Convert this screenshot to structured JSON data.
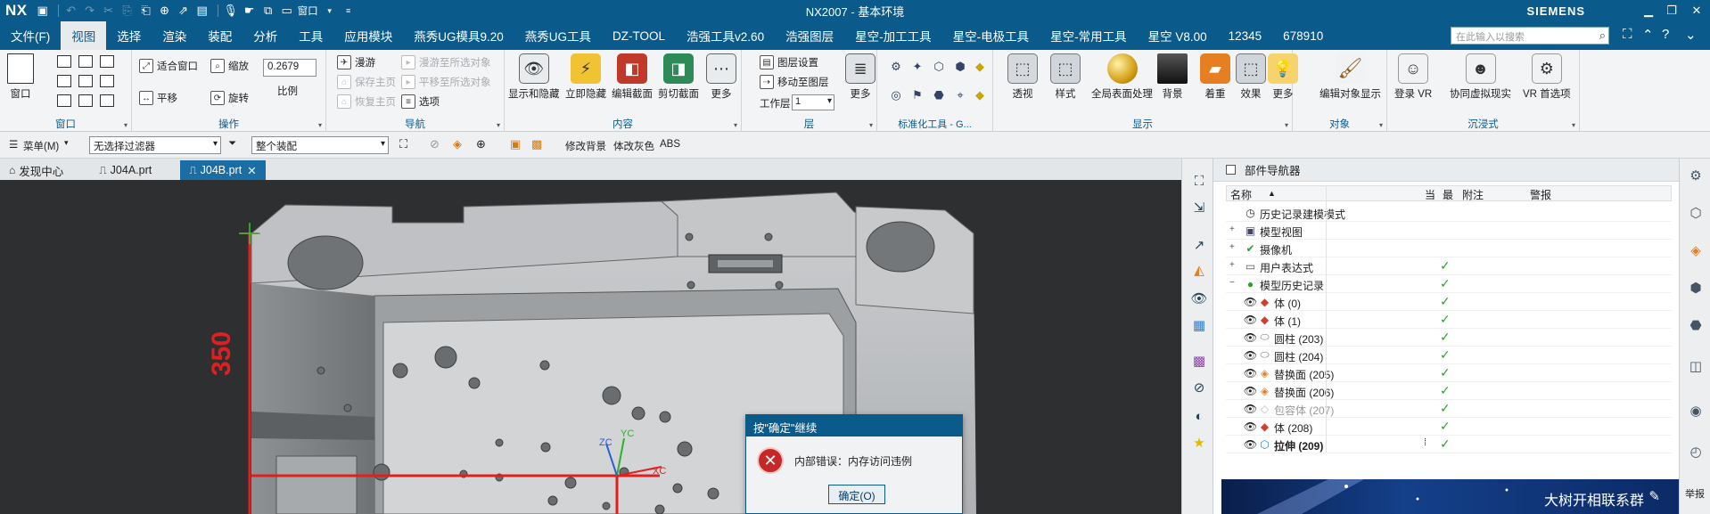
{
  "titlebar": {
    "logo": "NX",
    "window_menu_label": "窗口",
    "title": "NX2007 - 基本环境",
    "brand": "SIEMENS"
  },
  "menubar": {
    "items": [
      "文件(F)",
      "视图",
      "选择",
      "渲染",
      "装配",
      "分析",
      "工具",
      "应用模块",
      "燕秀UG模具9.20",
      "燕秀UG工具",
      "DZ-TOOL",
      "浩强工具v2.60",
      "浩强图层",
      "星空-加工工具",
      "星空-电极工具",
      "星空-常用工具",
      "星空 V8.00",
      "12345",
      "678910"
    ],
    "active_index": 1,
    "search_placeholder": "在此输入以搜索"
  },
  "ribbon": {
    "window_group": {
      "label": "窗口",
      "big_btn": "窗口"
    },
    "operate_group": {
      "label": "操作",
      "fit": "适合窗口",
      "zoom": "缩放",
      "pan": "平移",
      "rotate": "旋转",
      "scale_value": "0.2679",
      "scale_label": "比例"
    },
    "nav_group": {
      "label": "导航",
      "roam": "漫游",
      "save_home": "保存主页",
      "restore_home": "恢复主页",
      "roam_to_object": "漫游至所选对象",
      "pan_to_object": "平移至所选对象",
      "options": "选项"
    },
    "content_group": {
      "label": "内容",
      "show_hide": "显示和隐藏",
      "immediate_hide": "立即隐藏",
      "edit_section": "编辑截面",
      "clip_section": "剪切截面",
      "more": "更多"
    },
    "layer_group": {
      "label": "层",
      "layer_settings": "图层设置",
      "move_to_layer": "移动至图层",
      "work_layer_label": "工作层",
      "work_layer_value": "1",
      "more": "更多"
    },
    "std_tools_group": {
      "label": "标准化工具 - G..."
    },
    "display_group": {
      "label": "显示",
      "perspective": "透视",
      "style": "样式",
      "full_surface": "全局表面处理",
      "background": "背景",
      "shading": "着重",
      "effects": "效果",
      "more": "更多"
    },
    "object_group": {
      "label": "对象",
      "edit_display": "编辑对象显示"
    },
    "immersive_group": {
      "label": "沉浸式",
      "login_vr": "登录 VR",
      "collab_vr": "协同虚拟现实",
      "vr_prefs": "VR 首选项"
    }
  },
  "selbar": {
    "menu_label": "菜单(M)",
    "filter_value": "无选择过滤器",
    "scope_value": "整个装配",
    "modify_bg": "修改背景",
    "gray_body": "体改灰色",
    "abs": "ABS"
  },
  "tabs": [
    {
      "label": "发现中心",
      "active": false
    },
    {
      "label": "J04A.prt",
      "active": false
    },
    {
      "label": "J04B.prt",
      "active": true
    }
  ],
  "viewport": {
    "dim_label": "350",
    "axis_zc": "ZC",
    "axis_yc": "YC",
    "axis_xc": "XC"
  },
  "dialog": {
    "title": "按\"确定\"继续",
    "message": "内部错误：内存访问违例",
    "ok_label": "确定(O)"
  },
  "navigator": {
    "title": "部件导航器",
    "columns": {
      "name": "名称",
      "current": "当",
      "latest": "最",
      "notes": "附注",
      "warning": "警报"
    },
    "rows": [
      {
        "label": "历史记录建模模式",
        "icon": "clock-icon",
        "tick": false
      },
      {
        "label": "模型视图",
        "icon": "model-view-icon",
        "tick": false
      },
      {
        "label": "摄像机",
        "icon": "camera-icon",
        "tick": false
      },
      {
        "label": "用户表达式",
        "icon": "folder-icon",
        "tick": true
      },
      {
        "label": "模型历史记录",
        "icon": "history-folder-icon",
        "tick": true
      },
      {
        "label": "体 (0)",
        "icon": "body-icon",
        "tick": true
      },
      {
        "label": "体 (1)",
        "icon": "body-icon",
        "tick": true
      },
      {
        "label": "圆柱 (203)",
        "icon": "cylinder-icon",
        "tick": true
      },
      {
        "label": "圆柱 (204)",
        "icon": "cylinder-icon",
        "tick": true
      },
      {
        "label": "替换面 (205)",
        "icon": "replace-face-icon",
        "tick": true
      },
      {
        "label": "替换面 (206)",
        "icon": "replace-face-icon",
        "tick": true
      },
      {
        "label": "包容体 (207)",
        "icon": "bounding-body-icon",
        "tick": true
      },
      {
        "label": "体 (208)",
        "icon": "body-icon",
        "tick": true
      },
      {
        "label": "拉伸 (209)",
        "icon": "extrude-icon",
        "tick": true
      }
    ]
  },
  "banner": {
    "text": "大树开相联系群"
  },
  "right_strip": {
    "text": "举报"
  },
  "colors": {
    "brand": "#0a5b8c",
    "tick": "#2aa12a",
    "error": "#c62828",
    "axis_red": "#e02020"
  }
}
